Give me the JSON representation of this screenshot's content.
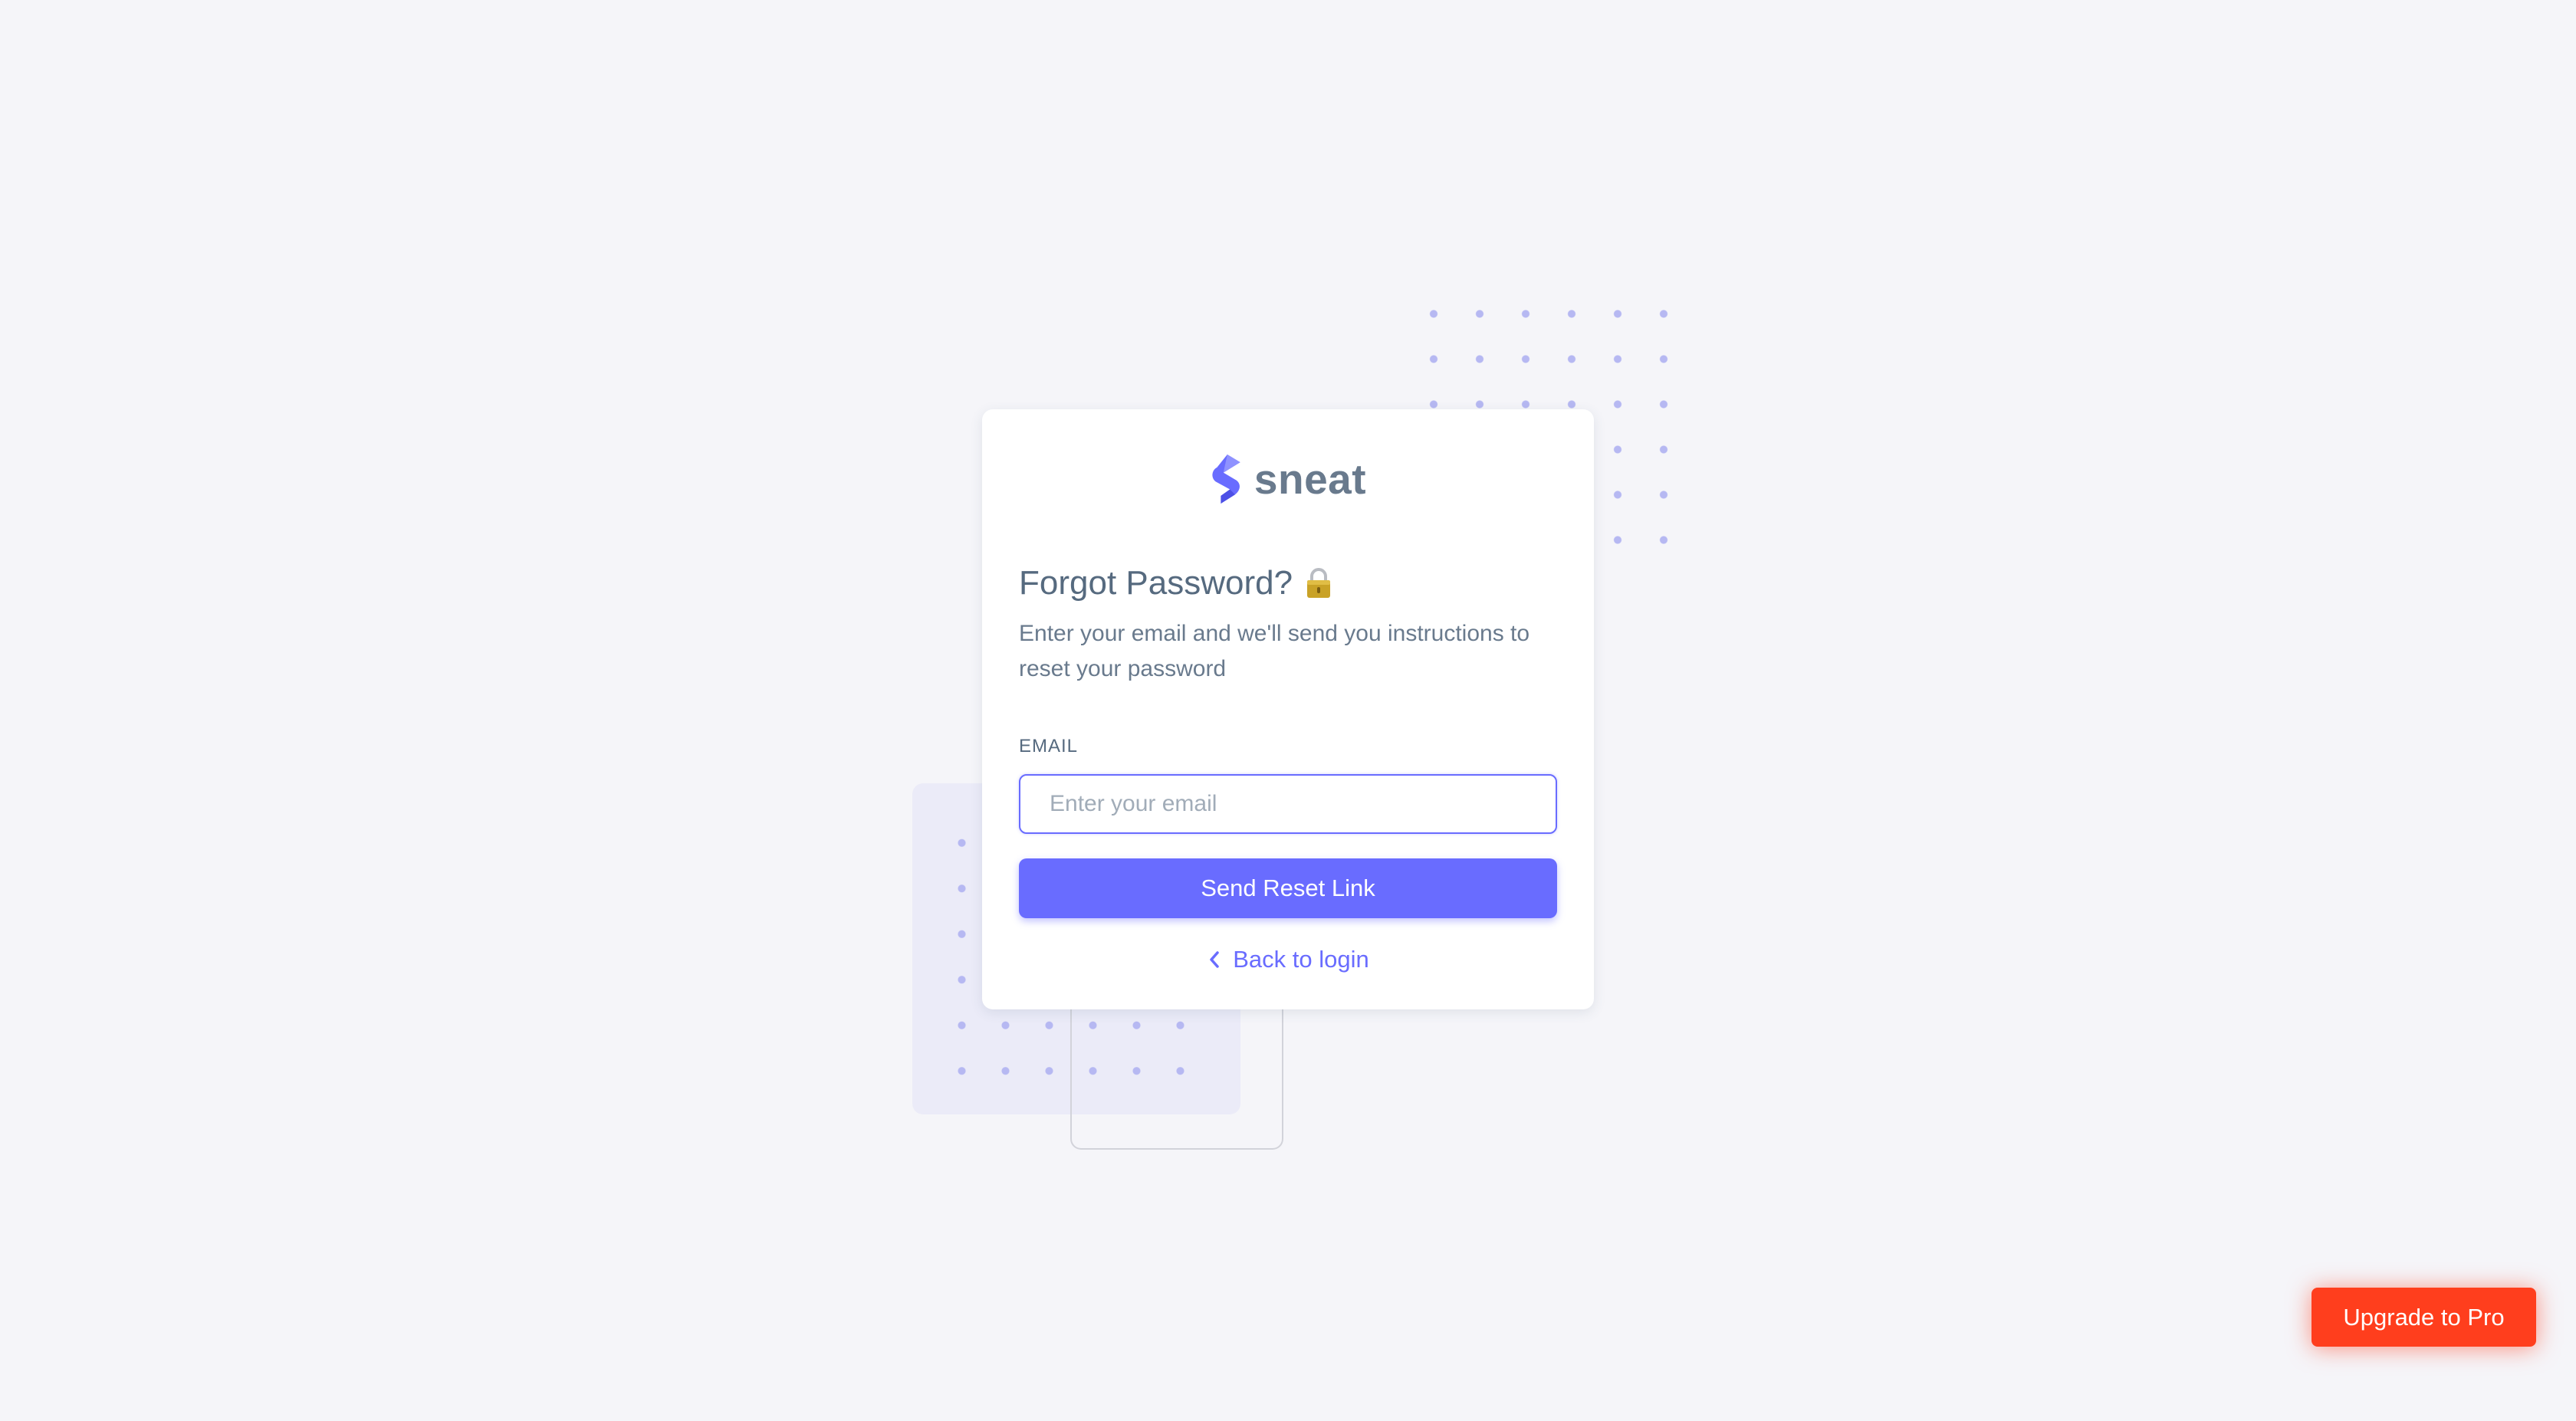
{
  "brand": {
    "name": "sneat",
    "logo_icon": "sneat-logo-icon"
  },
  "page": {
    "title": "Forgot Password?",
    "title_icon": "lock-icon",
    "subtitle": "Enter your email and we'll send you instructions to reset your password"
  },
  "form": {
    "email_label": "EMAIL",
    "email_placeholder": "Enter your email",
    "email_value": "",
    "submit_label": "Send Reset Link"
  },
  "links": {
    "back_to_login": "Back to login",
    "back_icon": "chevron-left-icon"
  },
  "upgrade": {
    "label": "Upgrade to Pro"
  },
  "colors": {
    "primary": "#696cff",
    "upgrade": "#ff3e1d",
    "background": "#f5f5f9",
    "heading": "#566a7f",
    "body_text": "#697a8d"
  }
}
